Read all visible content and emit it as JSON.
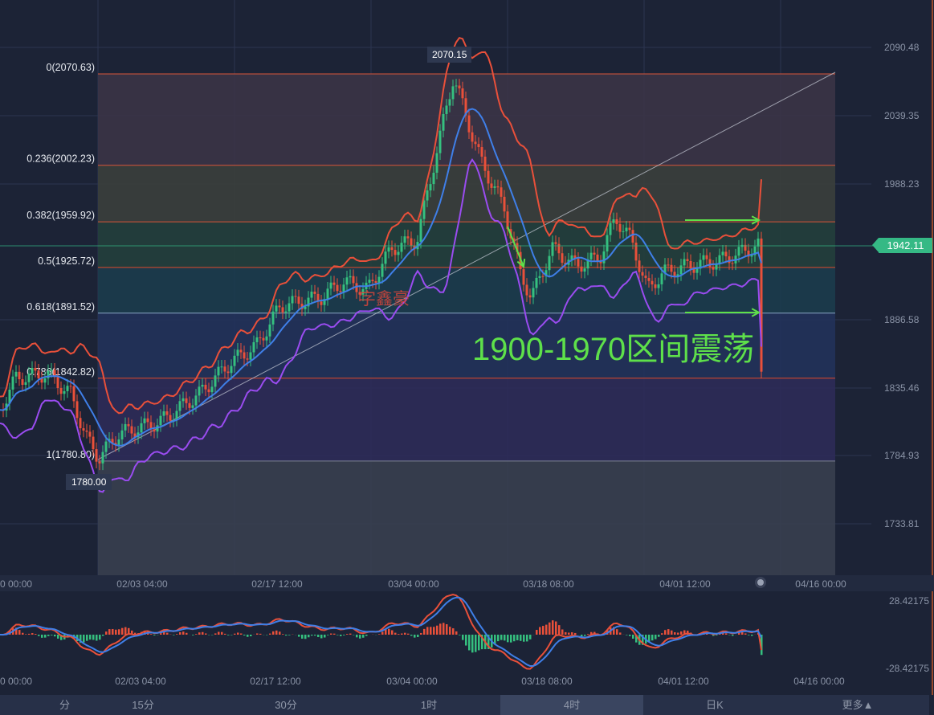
{
  "chart_data": {
    "type": "line",
    "title": "",
    "y_axis_ticks": [
      "2090.48",
      "2039.35",
      "1988.23",
      "1886.58",
      "1835.46",
      "1784.93",
      "1733.81"
    ],
    "x_axis_ticks": [
      "0 00:00",
      "02/03 04:00",
      "02/17 12:00",
      "03/04 00:00",
      "03/18 08:00",
      "04/01 12:00",
      "04/16 00:00"
    ],
    "ylim": [
      1733.81,
      2090.48
    ],
    "grid": true,
    "last_price": "1942.11",
    "high_label": "2070.15",
    "low_label": "1780.00",
    "price": [
      [
        "01/19 06:00",
        1819
      ],
      [
        "01/20 22:00",
        1843
      ],
      [
        "01/24 04:00",
        1846
      ],
      [
        "01/26 16:00",
        1831
      ],
      [
        "01/28 08:00",
        1798
      ],
      [
        "01/29 14:00",
        1783
      ],
      [
        "01/31 16:00",
        1801
      ],
      [
        "02/05 00:00",
        1810
      ],
      [
        "02/09 04:00",
        1831
      ],
      [
        "02/12 12:00",
        1855
      ],
      [
        "02/15 04:00",
        1867
      ],
      [
        "02/17 16:00",
        1897
      ],
      [
        "02/21 20:00",
        1903
      ],
      [
        "02/24 08:00",
        1915
      ],
      [
        "02/26 20:00",
        1909
      ],
      [
        "03/01 08:00",
        1940
      ],
      [
        "03/04 00:00",
        1946
      ],
      [
        "03/05 16:00",
        2000
      ],
      [
        "03/07 20:00",
        2069
      ],
      [
        "03/09 00:00",
        2042
      ],
      [
        "03/10 16:00",
        2006
      ],
      [
        "03/13 04:00",
        1970
      ],
      [
        "03/14 20:00",
        1922
      ],
      [
        "03/16 00:00",
        1903
      ],
      [
        "03/18 04:00",
        1940
      ],
      [
        "03/20 16:00",
        1927
      ],
      [
        "03/23 04:00",
        1933
      ],
      [
        "03/24 20:00",
        1963
      ],
      [
        "03/26 12:00",
        1946
      ],
      [
        "03/28 04:00",
        1909
      ],
      [
        "03/29 20:00",
        1922
      ],
      [
        "04/01 12:00",
        1927
      ],
      [
        "04/04 20:00",
        1931
      ],
      [
        "04/08 20:00",
        1942
      ]
    ],
    "fibonacci": [
      {
        "label": "0(2070.63)",
        "price": 2070.63,
        "line": "#d9553a",
        "fill": "#3b3446"
      },
      {
        "label": "0.236(2002.23)",
        "price": 2002.23,
        "line": "#d9553a",
        "fill": "#3b3f3c"
      },
      {
        "label": "0.382(1959.92)",
        "price": 1959.92,
        "line": "#d9553a",
        "fill": "#233f3c"
      },
      {
        "label": "0.5(1925.72)",
        "price": 1925.72,
        "line": "#e04a2a",
        "fill": "#1c3c4c"
      },
      {
        "label": "0.618(1891.52)",
        "price": 1891.52,
        "line": "#8aa6c4",
        "fill": "#22325a"
      },
      {
        "label": "0.786(1842.82)",
        "price": 1842.82,
        "line": "#e04a2a",
        "fill": "#2e2b58"
      },
      {
        "label": "1(1780.80)",
        "price": 1780.8,
        "line": "#7c8494",
        "fill": "#383f4f"
      }
    ],
    "macd": {
      "ylim_labels": [
        "28.42175",
        "-28.42175"
      ],
      "up_color": "#e9503a",
      "down_color": "#35c07f",
      "dif_color": "#e9503a",
      "dea_color": "#3f7fe8"
    },
    "colors": {
      "upper": "#e9503a",
      "middle": "#3f7fe8",
      "lower": "#9a4cf0",
      "up": "#35c07f",
      "down": "#e9503a"
    }
  },
  "annotations": {
    "watermark": "字鑫豪",
    "range_note": "1900-1970区间震荡"
  },
  "tabs": [
    {
      "label": "分",
      "selected": false
    },
    {
      "label": "15分",
      "selected": false
    },
    {
      "label": "30分",
      "selected": false
    },
    {
      "label": "1时",
      "selected": false
    },
    {
      "label": "4时",
      "selected": true
    },
    {
      "label": "日K",
      "selected": false
    },
    {
      "label": "更多▲",
      "selected": false
    }
  ]
}
